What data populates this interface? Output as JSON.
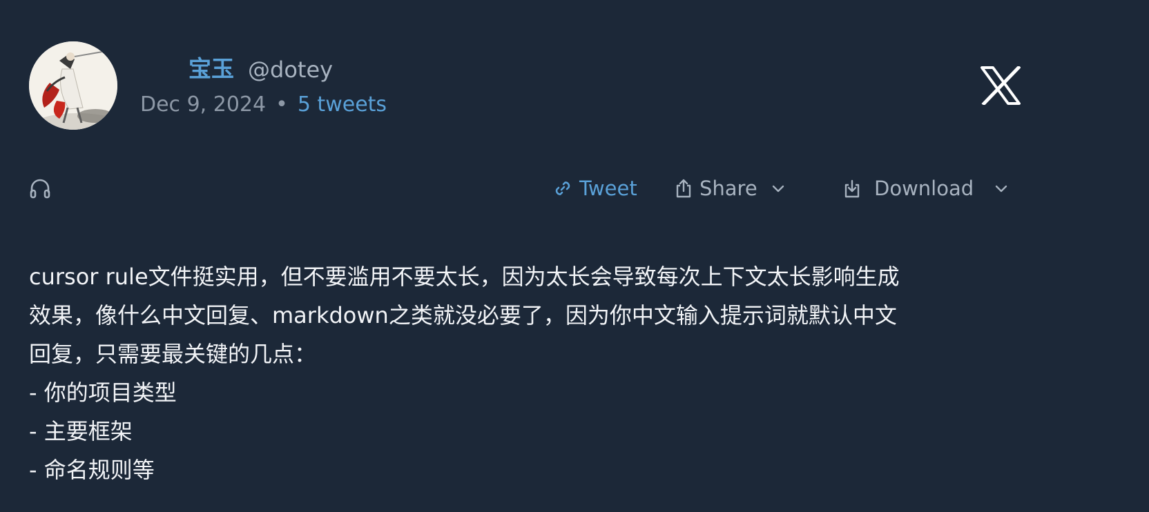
{
  "author": {
    "name": "宝玉",
    "handle": "@dotey"
  },
  "meta": {
    "date": "Dec 9, 2024",
    "separator": "•",
    "thread_count": "5 tweets"
  },
  "icons": {
    "logo": "x-logo-icon",
    "listen": "headphones-icon",
    "tweet": "link-icon",
    "share": "share-icon",
    "download": "download-icon",
    "dropdown": "chevron-down-icon"
  },
  "actions": {
    "tweet_label": "Tweet",
    "share_label": "Share",
    "download_label": "Download"
  },
  "tweet": {
    "lines": [
      "cursor rule文件挺实用，但不要滥用不要太长，因为太长会导致每次上下文太长影响生成",
      "效果，像什么中文回复、markdown之类就没必要了，因为你中文输入提示词就默认中文",
      "回复，只需要最关键的几点：",
      "- 你的项目类型",
      "- 主要框架",
      "- 命名规则等"
    ]
  },
  "colors": {
    "background": "#1c2838",
    "accent": "#5aa1d8",
    "muted": "#a8b3c0",
    "text": "#f2f4f7"
  }
}
